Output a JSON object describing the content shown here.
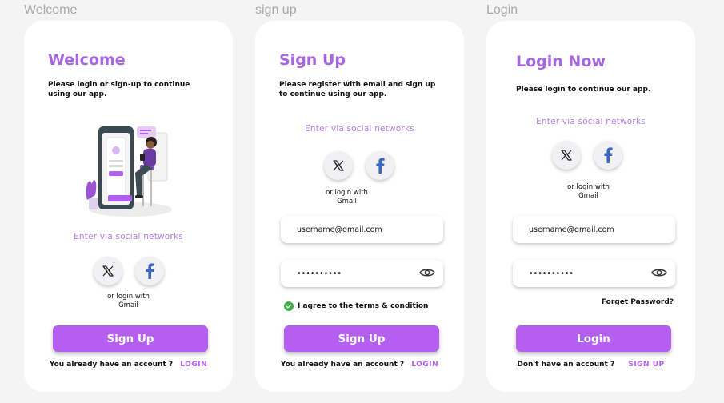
{
  "frames": {
    "welcome": {
      "label": "Welcome",
      "title": "Welcome",
      "subtitle": "Please login or sign-up to continue using our app.",
      "social_heading": "Enter via social networks",
      "twitter_icon": "x-logo-icon",
      "facebook_icon": "facebook-icon",
      "gmail_note_line1": "or login with",
      "gmail_note_line2": "Gmail",
      "primary_button": "Sign Up",
      "account_prompt": "You already have an account ?",
      "account_link": "LOGIN"
    },
    "signup": {
      "label": "sign up",
      "title": "Sign Up",
      "subtitle": "Please register with email and sign up to continue using our app.",
      "social_heading": "Enter via social networks",
      "gmail_note_line1": "or login with",
      "gmail_note_line2": "Gmail",
      "email_value": "username@gmail.com",
      "password_value": "••••••••••",
      "agree_text": "I agree to the terms & condition",
      "primary_button": "Sign Up",
      "account_prompt": "You already have an account ?",
      "account_link": "LOGIN"
    },
    "login": {
      "label": "Login",
      "title": "Login Now",
      "subtitle": "Please login to continue our app.",
      "social_heading": "Enter via social networks",
      "gmail_note_line1": "or login with",
      "gmail_note_line2": "Gmail",
      "email_value": "username@gmail.com",
      "password_value": "••••••••••",
      "forget_password": "Forget Password?",
      "primary_button": "Login",
      "account_prompt": "Don't have an account ?",
      "account_link": "SIGN UP"
    }
  },
  "colors": {
    "accent": "#b55ff0",
    "title": "#a765df",
    "social_heading": "#b37ee8",
    "facebook": "#3b66c4",
    "check": "#3eb04a",
    "background": "#f4f4f4"
  }
}
